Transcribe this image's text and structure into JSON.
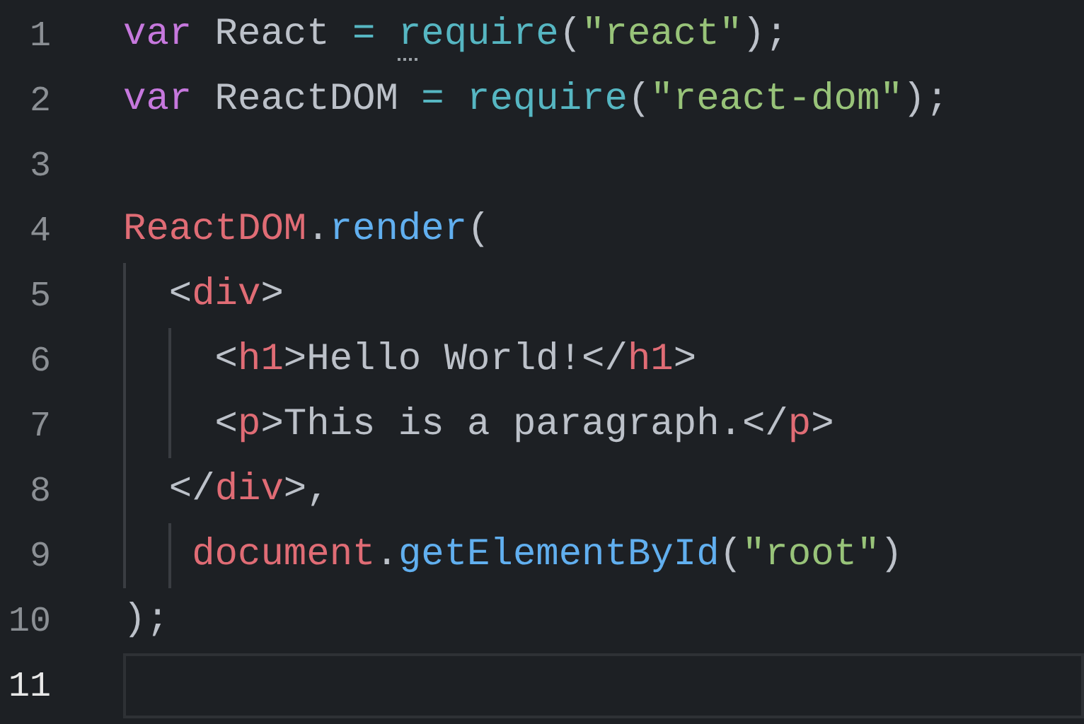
{
  "editor": {
    "lines": [
      {
        "number": "1",
        "current": false,
        "tokens": [
          {
            "text": "var",
            "kind": "keyword"
          },
          {
            "text": " React ",
            "kind": "plain"
          },
          {
            "text": "= ",
            "kind": "operator"
          },
          {
            "text": "r",
            "kind": "function",
            "lint": true
          },
          {
            "text": "equire",
            "kind": "function"
          },
          {
            "text": "(",
            "kind": "plain"
          },
          {
            "text": "\"react\"",
            "kind": "string"
          },
          {
            "text": ");",
            "kind": "plain"
          }
        ]
      },
      {
        "number": "2",
        "current": false,
        "tokens": [
          {
            "text": "var",
            "kind": "keyword"
          },
          {
            "text": " ReactDOM ",
            "kind": "plain"
          },
          {
            "text": "= ",
            "kind": "operator"
          },
          {
            "text": "require",
            "kind": "function"
          },
          {
            "text": "(",
            "kind": "plain"
          },
          {
            "text": "\"react-dom\"",
            "kind": "string"
          },
          {
            "text": ");",
            "kind": "plain"
          }
        ]
      },
      {
        "number": "3",
        "current": false
      },
      {
        "number": "4",
        "current": false,
        "tokens": [
          {
            "text": "ReactDOM",
            "kind": "variable"
          },
          {
            "text": ".",
            "kind": "plain"
          },
          {
            "text": "render",
            "kind": "method"
          },
          {
            "text": "(",
            "kind": "plain"
          }
        ]
      },
      {
        "number": "5",
        "current": false,
        "guides": [
          true
        ],
        "tokens": [
          {
            "text": "  <",
            "kind": "plain"
          },
          {
            "text": "div",
            "kind": "tag"
          },
          {
            "text": ">",
            "kind": "plain"
          }
        ]
      },
      {
        "number": "6",
        "current": false,
        "guides": [
          true,
          true
        ],
        "tokens": [
          {
            "text": "    <",
            "kind": "plain"
          },
          {
            "text": "h1",
            "kind": "tag"
          },
          {
            "text": ">Hello World!</",
            "kind": "plain"
          },
          {
            "text": "h1",
            "kind": "tag"
          },
          {
            "text": ">",
            "kind": "plain"
          }
        ]
      },
      {
        "number": "7",
        "current": false,
        "guides": [
          true,
          true
        ],
        "tokens": [
          {
            "text": "    <",
            "kind": "plain"
          },
          {
            "text": "p",
            "kind": "tag"
          },
          {
            "text": ">This is a paragraph.</",
            "kind": "plain"
          },
          {
            "text": "p",
            "kind": "tag"
          },
          {
            "text": ">",
            "kind": "plain"
          }
        ]
      },
      {
        "number": "8",
        "current": false,
        "guides": [
          true
        ],
        "tokens": [
          {
            "text": "  </",
            "kind": "plain"
          },
          {
            "text": "div",
            "kind": "tag"
          },
          {
            "text": ">,",
            "kind": "plain"
          }
        ]
      },
      {
        "number": "9",
        "current": false,
        "guides": [
          true,
          true
        ],
        "tokens": [
          {
            "text": "   document",
            "kind": "variable"
          },
          {
            "text": ".",
            "kind": "plain"
          },
          {
            "text": "getElementById",
            "kind": "method"
          },
          {
            "text": "(",
            "kind": "plain"
          },
          {
            "text": "\"root\"",
            "kind": "string"
          },
          {
            "text": ")",
            "kind": "plain"
          }
        ]
      },
      {
        "number": "10",
        "current": false,
        "tokens": [
          {
            "text": ");",
            "kind": "plain"
          }
        ]
      },
      {
        "number": "11",
        "current": true
      }
    ]
  }
}
